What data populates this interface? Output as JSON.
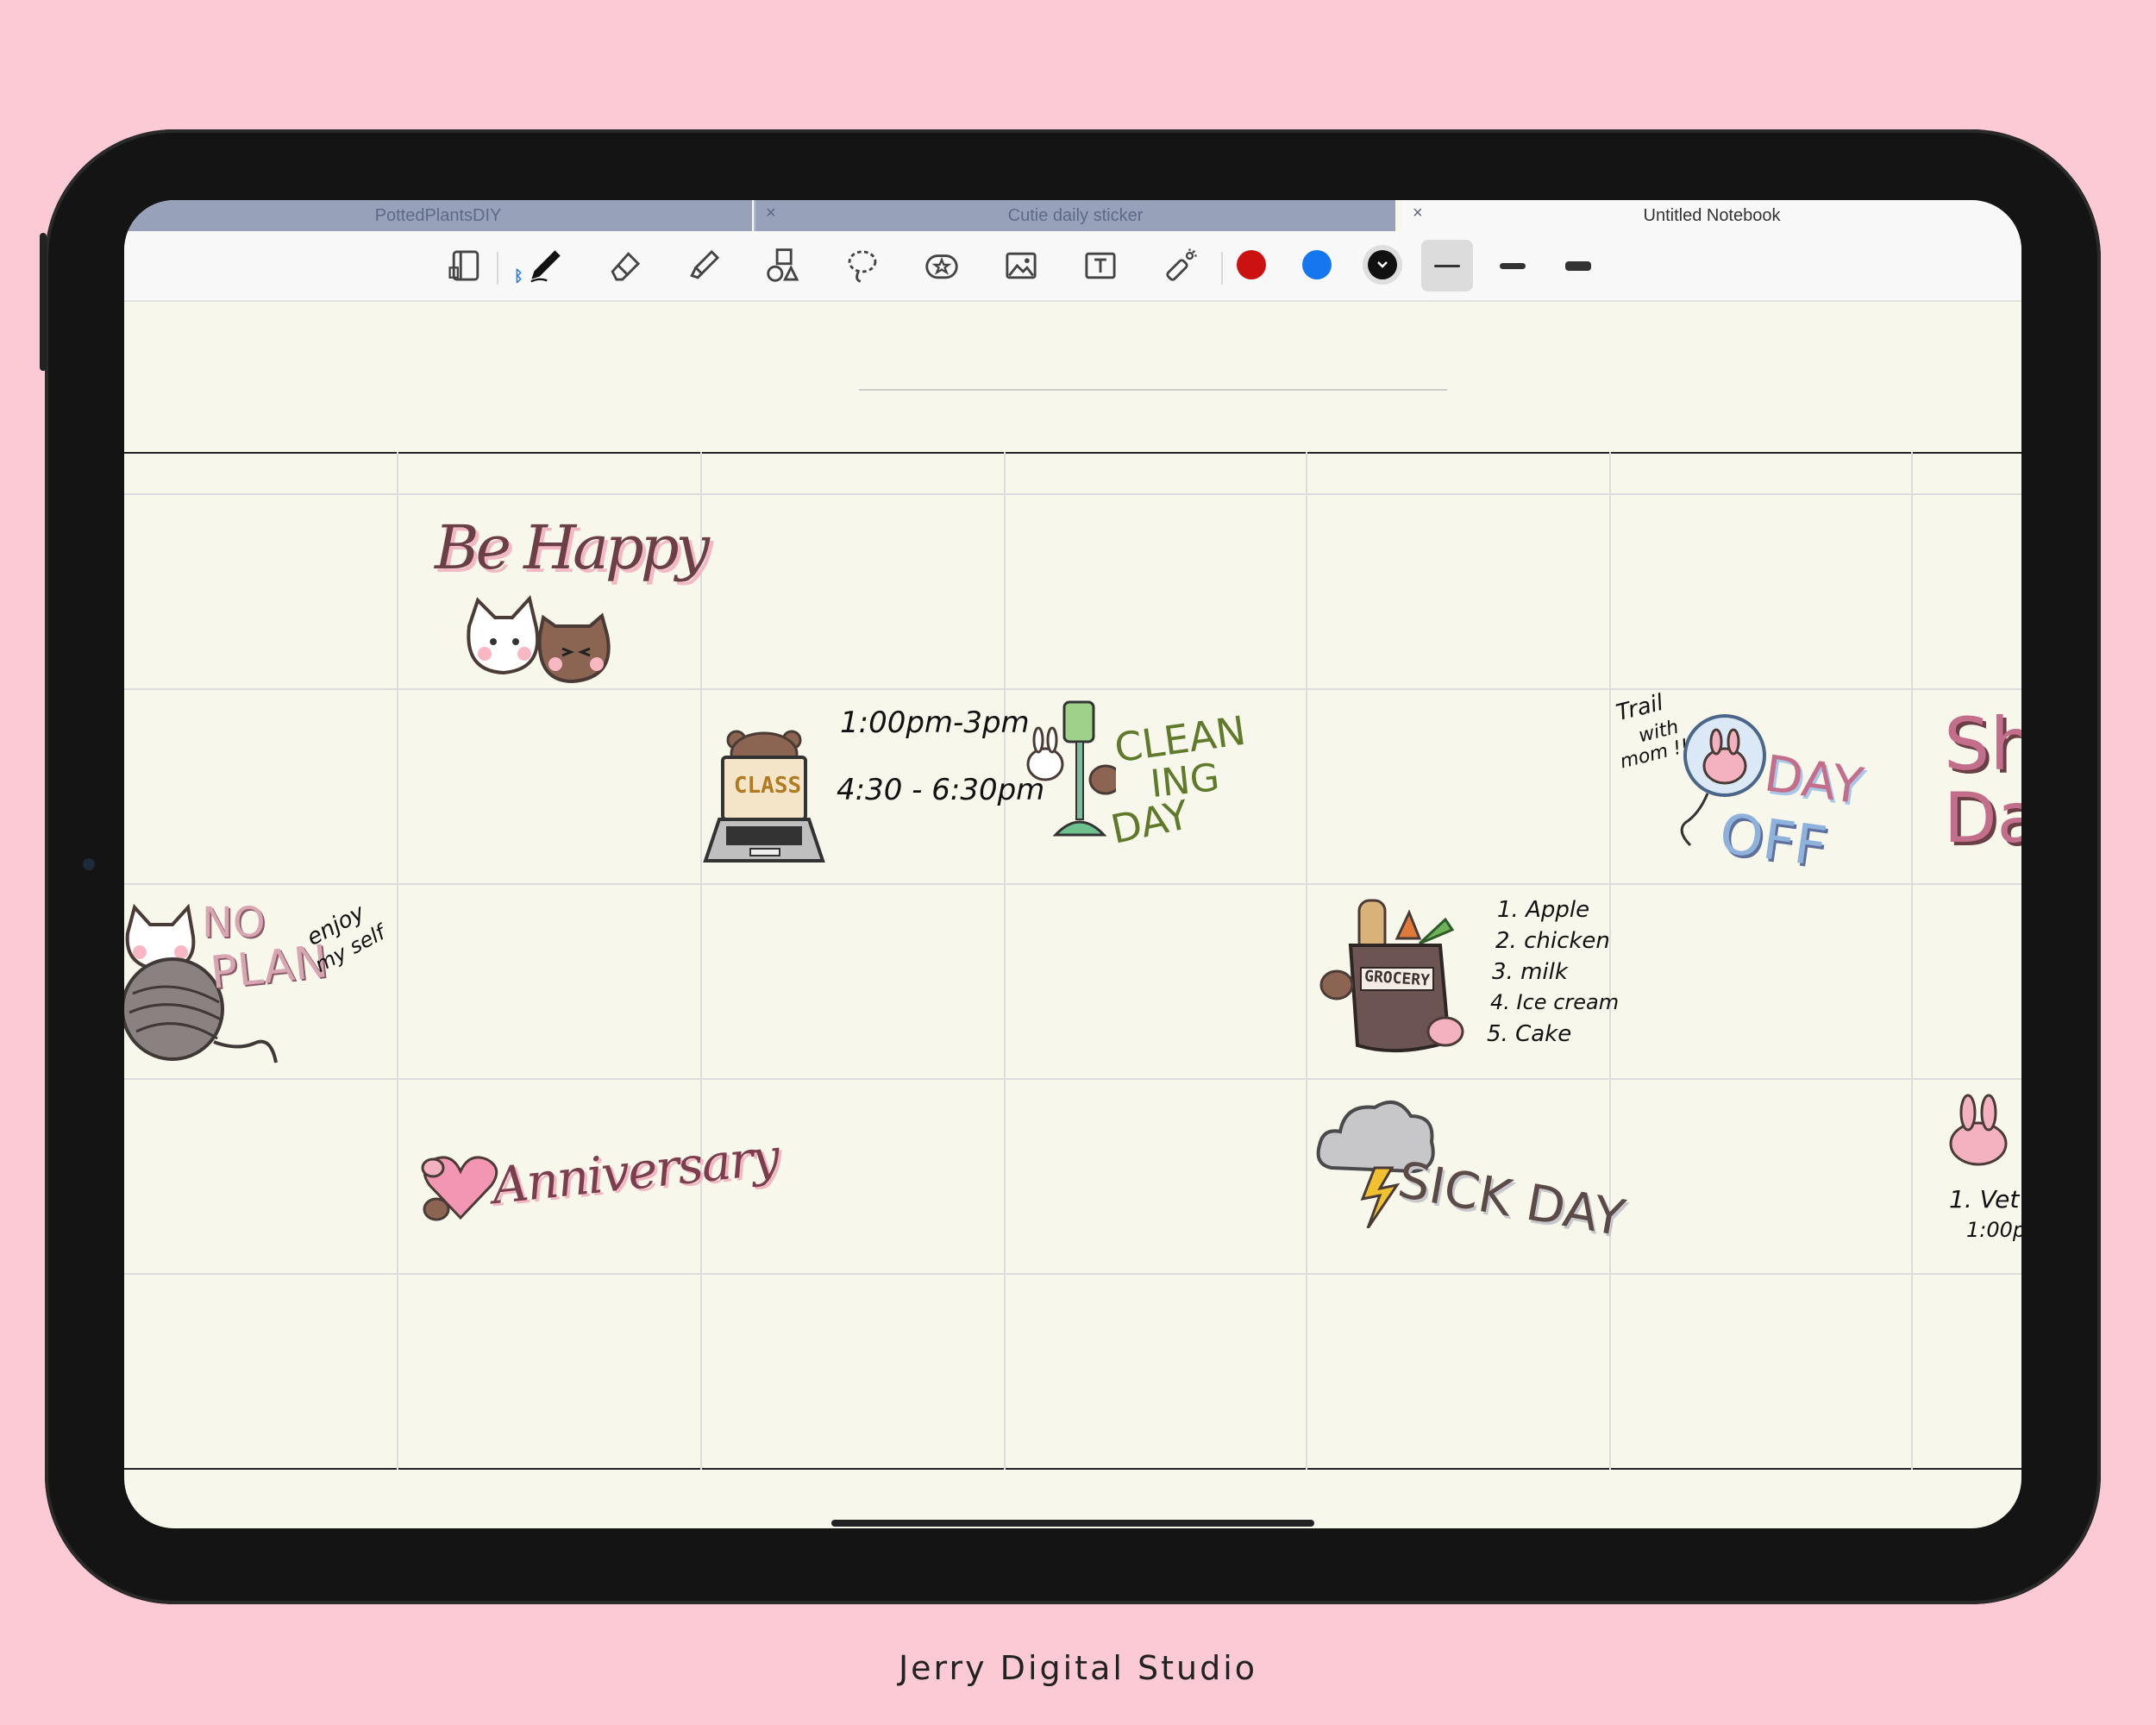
{
  "tabs": [
    {
      "label": "PottedPlantsDIY",
      "active": false
    },
    {
      "label": "Cutie daily sticker",
      "active": false
    },
    {
      "label": "Untitled Notebook",
      "active": true
    }
  ],
  "tab_close_glyph": "×",
  "toolbar": {
    "tools": [
      "page-layout-icon",
      "pen-icon",
      "eraser-icon",
      "highlighter-icon",
      "shapes-icon",
      "lasso-icon",
      "sticker-icon",
      "image-icon",
      "text-box-icon",
      "laser-pointer-icon"
    ],
    "colors": [
      "#cc1111",
      "#1477f0",
      "#111111"
    ],
    "selected_color": "#111111",
    "stroke_widths": [
      "thin",
      "medium",
      "thick"
    ],
    "selected_width": "thin"
  },
  "stickers": {
    "be_happy": "Be Happy",
    "class_label": "CLASS",
    "class_times": [
      "1:00pm-3pm",
      "4:30 - 6:30pm"
    ],
    "cleaning_day": [
      "CLEAN",
      "ING",
      "DAY"
    ],
    "day_off": [
      "DAY",
      "OFF"
    ],
    "trail_note": [
      "Trail",
      "with",
      "mom !!"
    ],
    "no_plan": [
      "NO",
      "PLAN"
    ],
    "enjoy_note": [
      "enjoy",
      "my self"
    ],
    "grocery_label": "GROCERY",
    "grocery_list": [
      "1. Apple",
      "2. chicken",
      "3. milk",
      "4. Ice cream",
      "5. Cake"
    ],
    "anniversary": "Anniversary",
    "sick_day": "SICK DAY",
    "partial_sh": [
      "Sh",
      "Da"
    ],
    "partial_note": [
      "1. Vet",
      "1:00p"
    ]
  },
  "credit": "Jerry Digital Studio"
}
